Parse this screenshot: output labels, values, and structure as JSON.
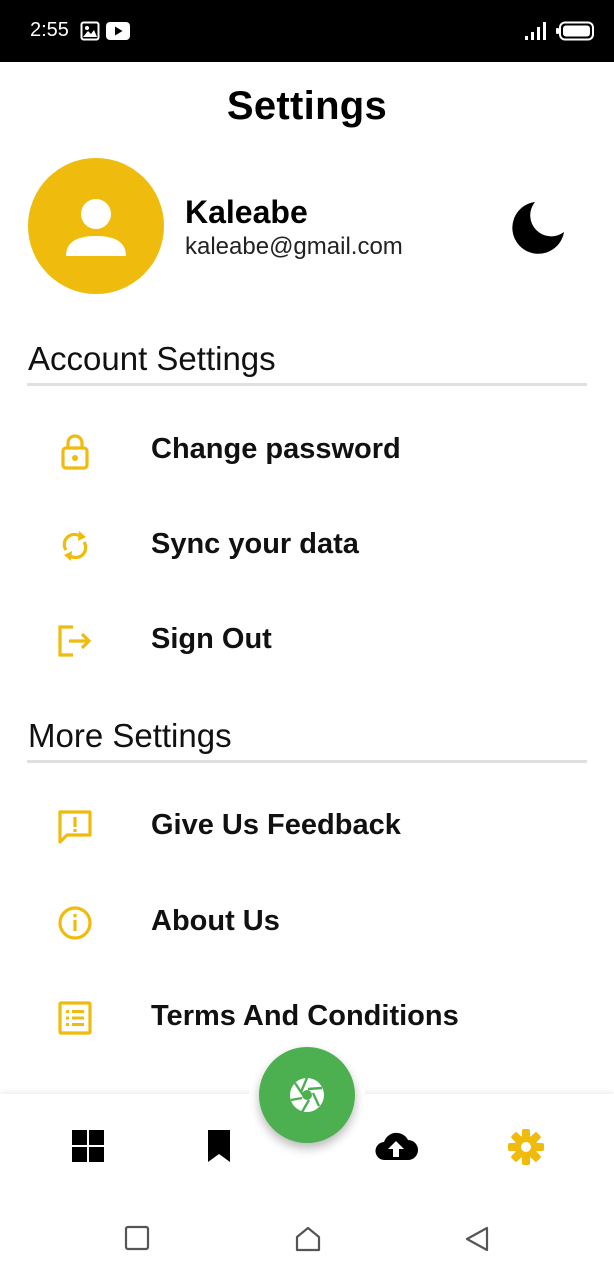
{
  "status_bar": {
    "time": "2:55",
    "icons": [
      "image-icon",
      "youtube-icon",
      "signal-icon",
      "battery-icon"
    ]
  },
  "page": {
    "title": "Settings"
  },
  "profile": {
    "name": "Kaleabe",
    "email": "kaleabe@gmail.com",
    "avatar_icon": "person-icon",
    "theme_toggle_icon": "moon-icon"
  },
  "account_section": {
    "header": "Account Settings",
    "items": [
      {
        "label": "Change password",
        "icon": "lock-icon"
      },
      {
        "label": "Sync your data",
        "icon": "sync-icon"
      },
      {
        "label": "Sign Out",
        "icon": "logout-icon"
      }
    ]
  },
  "more_section": {
    "header": "More Settings",
    "items": [
      {
        "label": "Give Us Feedback",
        "icon": "feedback-icon"
      },
      {
        "label": "About Us",
        "icon": "info-icon"
      },
      {
        "label": "Terms And Conditions",
        "icon": "list-icon"
      }
    ]
  },
  "bottom_nav": {
    "items": [
      "dashboard-icon",
      "bookmark-icon",
      "cloud-upload-icon",
      "settings-gear-icon"
    ],
    "active": "settings-gear-icon",
    "fab_icon": "camera-shutter-icon"
  },
  "colors": {
    "accent": "#efbb0c",
    "fab": "#4caf50",
    "status_bar": "#000000",
    "divider": "#e0e0e0"
  }
}
